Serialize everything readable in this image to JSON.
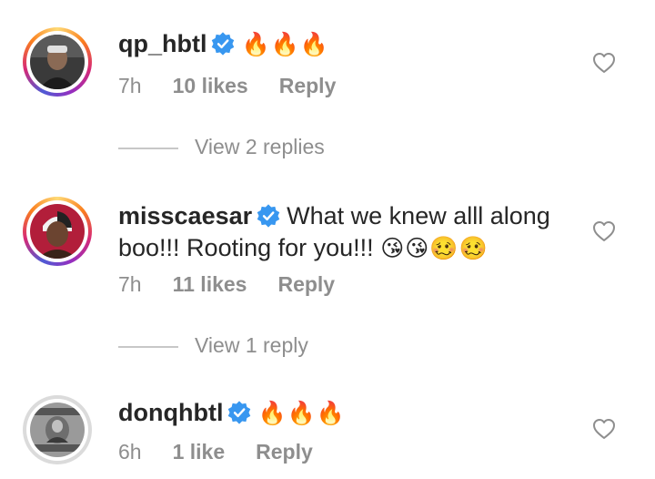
{
  "comments": [
    {
      "username": "qp_hbtl",
      "text": "",
      "emoji": "🔥🔥🔥",
      "time": "7h",
      "likes": "10 likes",
      "reply": "Reply",
      "view_replies": "View 2 replies"
    },
    {
      "username": "misscaesar",
      "text": "What we knew alll along boo!!! Rooting for you!!!",
      "emoji": "😘😘🥴🥴",
      "time": "7h",
      "likes": "11 likes",
      "reply": "Reply",
      "view_replies": "View 1 reply"
    },
    {
      "username": "donqhbtl",
      "text": "",
      "emoji": "🔥🔥🔥",
      "time": "6h",
      "likes": "1 like",
      "reply": "Reply"
    }
  ],
  "icons": {
    "verified": "verified-badge-icon",
    "like": "heart-outline-icon"
  },
  "colors": {
    "verified_blue": "#3897f0",
    "muted": "#8e8e8e",
    "text": "#262626"
  }
}
